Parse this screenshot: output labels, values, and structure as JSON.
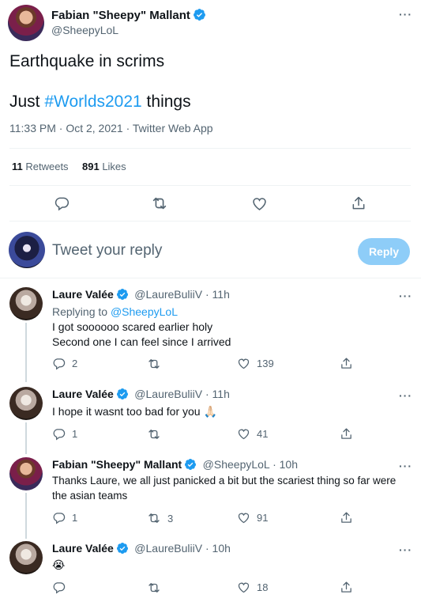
{
  "main_tweet": {
    "author_name": "Fabian \"Sheepy\" Mallant",
    "handle": "@SheepyLoL",
    "line1": "Earthquake in scrims",
    "line2_pre": "Just ",
    "hashtag": "#Worlds2021",
    "line2_post": " things",
    "timestamp": "11:33 PM · Oct 2, 2021 · Twitter Web App",
    "retweets_count": "11",
    "retweets_label": " Retweets",
    "likes_count": "891",
    "likes_label": " Likes"
  },
  "composer": {
    "placeholder": "Tweet your reply",
    "reply_button": "Reply"
  },
  "replies": [
    {
      "name": "Laure Valée",
      "handle_time": "@LaureBuliiV · 11h",
      "replying_prefix": "Replying to ",
      "replying_to": "@SheepyLoL",
      "line1": "I got soooooo scared earlier holy",
      "line2": "Second one I can feel since I arrived",
      "reply_count": "2",
      "retweet_count": "",
      "like_count": "139"
    },
    {
      "name": "Laure Valée",
      "handle_time": "@LaureBuliiV · 11h",
      "line1": "I hope it wasnt too bad for you 🙏🏻",
      "reply_count": "1",
      "retweet_count": "",
      "like_count": "41"
    },
    {
      "name": "Fabian \"Sheepy\" Mallant",
      "handle_time": "@SheepyLoL · 10h",
      "line1": "Thanks Laure, we all just panicked a bit but the scariest thing so far were",
      "line2": "the asian teams",
      "reply_count": "1",
      "retweet_count": "3",
      "like_count": "91"
    },
    {
      "name": "Laure Valée",
      "handle_time": "@LaureBuliiV · 10h",
      "line1": "😭",
      "reply_count": "",
      "retweet_count": "",
      "like_count": "18"
    }
  ],
  "icons": [
    "more-icon",
    "verified-icon",
    "reply-icon",
    "retweet-icon",
    "like-icon",
    "share-icon"
  ],
  "colors": {
    "accent": "#1d9bf0",
    "reply_button_bg": "#8ecdf8",
    "muted": "#536471",
    "divider": "#eff3f4"
  }
}
